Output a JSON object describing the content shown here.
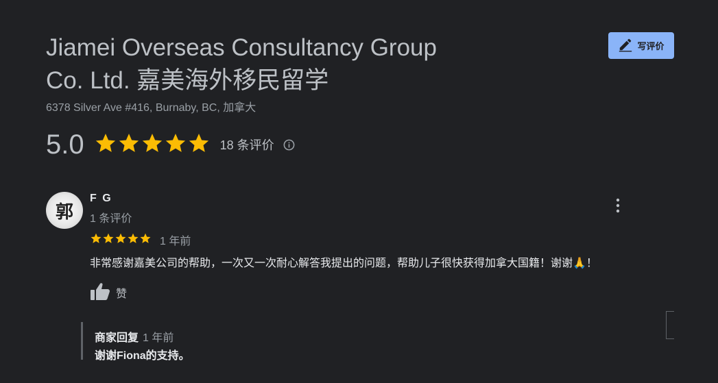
{
  "business": {
    "title_line1": "Jiamei Overseas Consultancy Group",
    "title_line2": "Co. Ltd. 嘉美海外移民留学",
    "address": "6378 Silver Ave #416, Burnaby, BC, 加拿大",
    "write_review_label": "写评价",
    "rating": "5.0",
    "stars": 5,
    "review_count": "18 条评价"
  },
  "review": {
    "avatar_char": "郭",
    "reviewer_name": "F G",
    "reviewer_sub": "1 条评价",
    "stars": 5,
    "time": "1 年前",
    "text": "非常感谢嘉美公司的帮助，一次又一次耐心解答我提出的问题，帮助儿子很快获得加拿大国籍！谢谢🙏！",
    "like_label": "赞",
    "owner_reply": {
      "title": "商家回复",
      "time": "1 年前",
      "text": "谢谢Fiona的支持。"
    }
  },
  "colors": {
    "background": "#202124",
    "star": "#fbbc04",
    "accent_button": "#8ab4f8"
  },
  "icons": [
    "edit-pencil-icon",
    "star-icon",
    "info-icon",
    "more-vert-icon",
    "thumb-up-icon"
  ]
}
